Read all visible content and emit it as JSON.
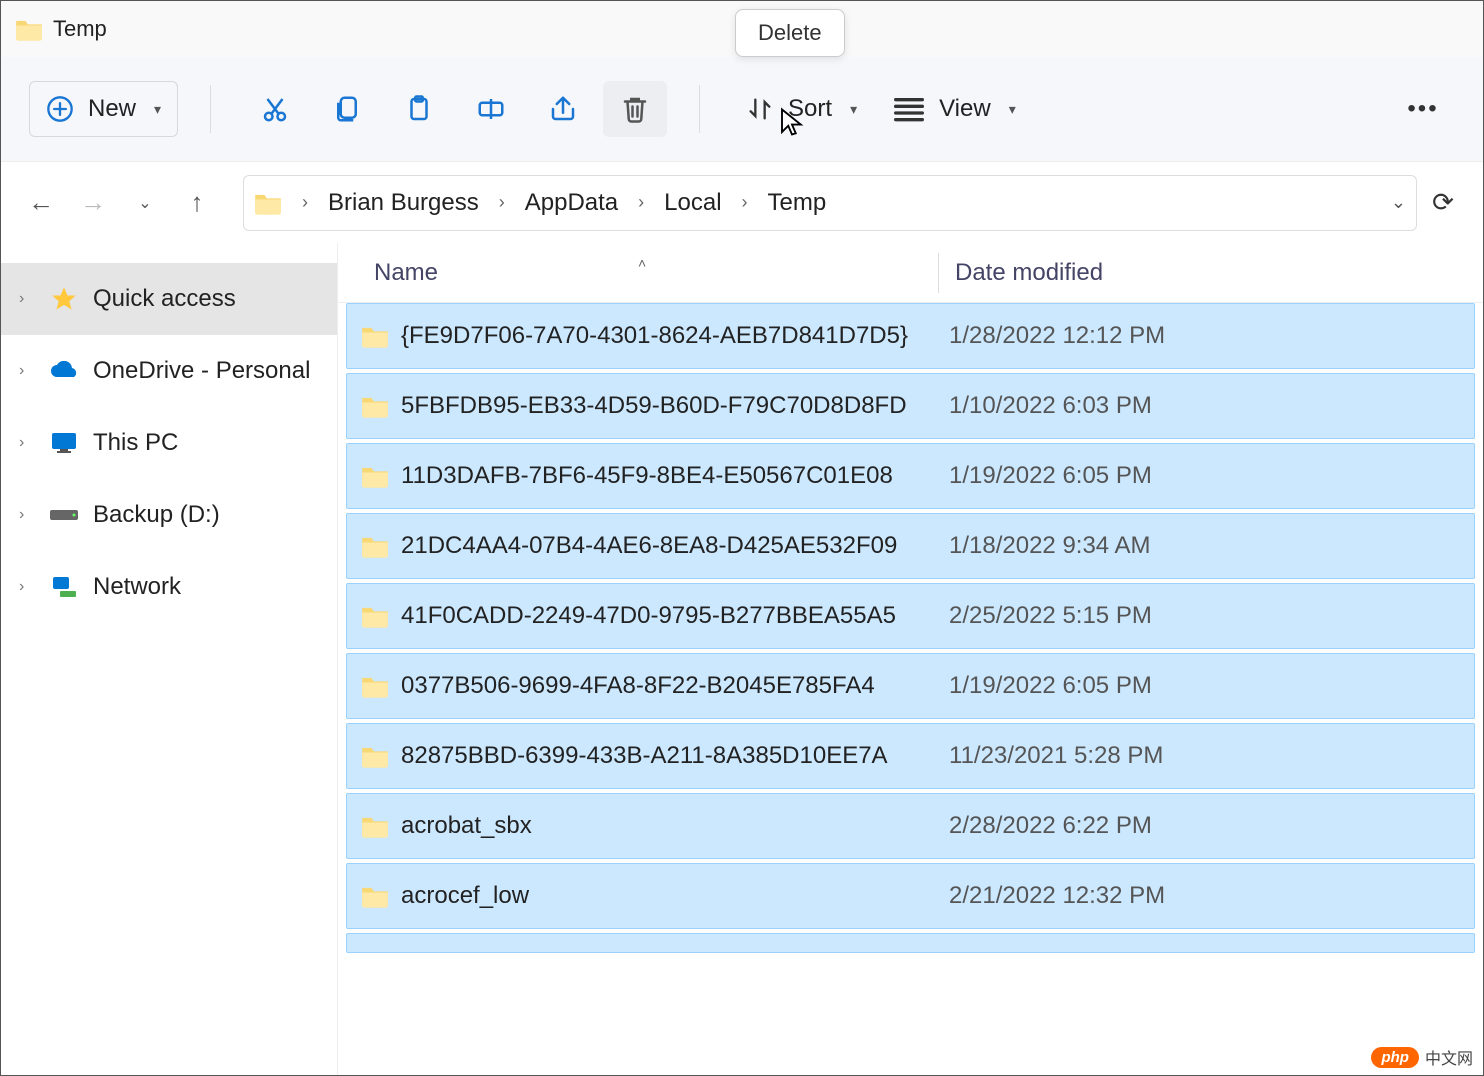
{
  "window": {
    "title": "Temp"
  },
  "tooltip": {
    "delete": "Delete"
  },
  "toolbar": {
    "new_label": "New",
    "sort_label": "Sort",
    "view_label": "View"
  },
  "breadcrumb": {
    "items": [
      "Brian Burgess",
      "AppData",
      "Local",
      "Temp"
    ]
  },
  "sidebar": {
    "items": [
      {
        "label": "Quick access",
        "icon": "star",
        "active": true
      },
      {
        "label": "OneDrive - Personal",
        "icon": "onedrive",
        "active": false
      },
      {
        "label": "This PC",
        "icon": "pc",
        "active": false
      },
      {
        "label": "Backup (D:)",
        "icon": "drive",
        "active": false
      },
      {
        "label": "Network",
        "icon": "network",
        "active": false
      }
    ]
  },
  "columns": {
    "name": "Name",
    "date": "Date modified"
  },
  "files": [
    {
      "name": "{FE9D7F06-7A70-4301-8624-AEB7D841D7D5}",
      "date": "1/28/2022 12:12 PM"
    },
    {
      "name": "5FBFDB95-EB33-4D59-B60D-F79C70D8D8FD",
      "date": "1/10/2022 6:03 PM"
    },
    {
      "name": "11D3DAFB-7BF6-45F9-8BE4-E50567C01E08",
      "date": "1/19/2022 6:05 PM"
    },
    {
      "name": "21DC4AA4-07B4-4AE6-8EA8-D425AE532F09",
      "date": "1/18/2022 9:34 AM"
    },
    {
      "name": "41F0CADD-2249-47D0-9795-B277BBEA55A5",
      "date": "2/25/2022 5:15 PM"
    },
    {
      "name": "0377B506-9699-4FA8-8F22-B2045E785FA4",
      "date": "1/19/2022 6:05 PM"
    },
    {
      "name": "82875BBD-6399-433B-A211-8A385D10EE7A",
      "date": "11/23/2021 5:28 PM"
    },
    {
      "name": "acrobat_sbx",
      "date": "2/28/2022 6:22 PM"
    },
    {
      "name": "acrocef_low",
      "date": "2/21/2022 12:32 PM"
    }
  ],
  "watermark": {
    "badge": "php",
    "text": "中文网"
  }
}
